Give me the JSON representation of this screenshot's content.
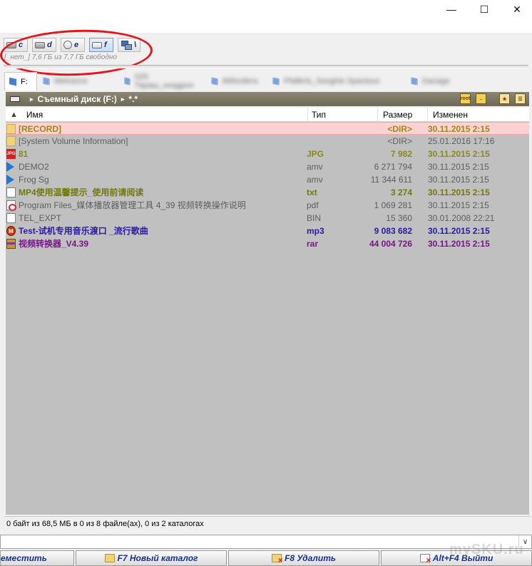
{
  "window": {
    "minimize_glyph": "—",
    "maximize_glyph": "☐",
    "close_glyph": "✕"
  },
  "drives": [
    {
      "letter": "c",
      "icon": "hdd-icon",
      "active": false
    },
    {
      "letter": "d",
      "icon": "hdd-icon",
      "active": false
    },
    {
      "letter": "e",
      "icon": "cdrom-icon",
      "active": false
    },
    {
      "letter": "f",
      "icon": "removable-disk-icon",
      "active": true
    },
    {
      "letter": "\\",
      "icon": "network-icon",
      "active": false
    }
  ],
  "free_space": "[_нет_]  7,6 ГБ из  7,7 ГБ свободно",
  "tabs": [
    {
      "label": "F:",
      "active": true
    },
    {
      "label": "Wetrance",
      "active": false,
      "blurred": true
    },
    {
      "label": "029 Тараш_ннадрон",
      "active": false,
      "blurred": true
    },
    {
      "label": "86fondera",
      "active": false,
      "blurred": true
    },
    {
      "label": "Pfallkrts_Seoghie Spanious",
      "active": false,
      "blurred": true
    },
    {
      "label": "Danage",
      "active": false,
      "blurred": true
    }
  ],
  "path": {
    "drive_label": "Съемный диск (F:)",
    "current": "*.*",
    "sep": "▸"
  },
  "columns": {
    "sort_glyph": "▲",
    "name": "Имя",
    "type": "Тип",
    "size": "Размер",
    "modified": "Изменен"
  },
  "files": [
    {
      "name": "[RECORD]",
      "type": "",
      "size": "<DIR>",
      "date": "30.11.2015 2:15",
      "icon": "folder-icon",
      "color": "#9a8a1a",
      "bold": true,
      "selected": true
    },
    {
      "name": "[System Volume Information]",
      "type": "",
      "size": "<DIR>",
      "date": "25.01.2016 17:16",
      "icon": "folder-icon",
      "color": "#5e5e5e",
      "bold": false,
      "selected": false
    },
    {
      "name": "81",
      "type": "JPG",
      "size": "7 982",
      "date": "30.11.2015 2:15",
      "icon": "jpg-icon",
      "color": "#8a8a1a",
      "bold": true,
      "selected": false
    },
    {
      "name": "DEMO2",
      "type": "amv",
      "size": "6 271 794",
      "date": "30.11.2015 2:15",
      "icon": "play-icon",
      "color": "#5e5e5e",
      "bold": false,
      "selected": false
    },
    {
      "name": "Frog Sg",
      "type": "amv",
      "size": "11 344 611",
      "date": "30.11.2015 2:15",
      "icon": "play-icon",
      "color": "#5e5e5e",
      "bold": false,
      "selected": false
    },
    {
      "name": "MP4使用温馨提示_使用前请阅读",
      "type": "txt",
      "size": "3 274",
      "date": "30.11.2015 2:15",
      "icon": "text-file-icon",
      "color": "#6f7a0e",
      "bold": true,
      "selected": false
    },
    {
      "name": "Program Files_媒体播放器管理工具 4_39 视频转换操作说明",
      "type": "pdf",
      "size": "1 069 281",
      "date": "30.11.2015 2:15",
      "icon": "pdf-icon",
      "color": "#5e5e5e",
      "bold": false,
      "selected": false
    },
    {
      "name": "TEL_EXPT",
      "type": "BIN",
      "size": "15 360",
      "date": "30.01.2008 22:21",
      "icon": "file-icon",
      "color": "#5e5e5e",
      "bold": false,
      "selected": false
    },
    {
      "name": "Test-试机专用音乐渡口 _流行歌曲",
      "type": "mp3",
      "size": "9 083 682",
      "date": "30.11.2015 2:15",
      "icon": "mp3-icon",
      "color": "#2a1aa0",
      "bold": true,
      "selected": false
    },
    {
      "name": "视频转换器_V4.39",
      "type": "rar",
      "size": "44 004 726",
      "date": "30.11.2015 2:15",
      "icon": "archive-icon",
      "color": "#7a148a",
      "bold": true,
      "selected": false
    }
  ],
  "status": "0 байт из 68,5 МБ в 0 из 8 файле(ах), 0 из 2 каталогах",
  "cmdline": {
    "value": "",
    "chevron": "∨"
  },
  "fkeys": [
    {
      "label": "еместить",
      "icon": ""
    },
    {
      "label": "F7 Новый каталог",
      "icon": "new-folder-icon"
    },
    {
      "label": "F8 Удалить",
      "icon": "delete-icon"
    },
    {
      "label": "Alt+F4 Выйти",
      "icon": "exit-icon"
    }
  ],
  "watermark": "mySKU.ru"
}
